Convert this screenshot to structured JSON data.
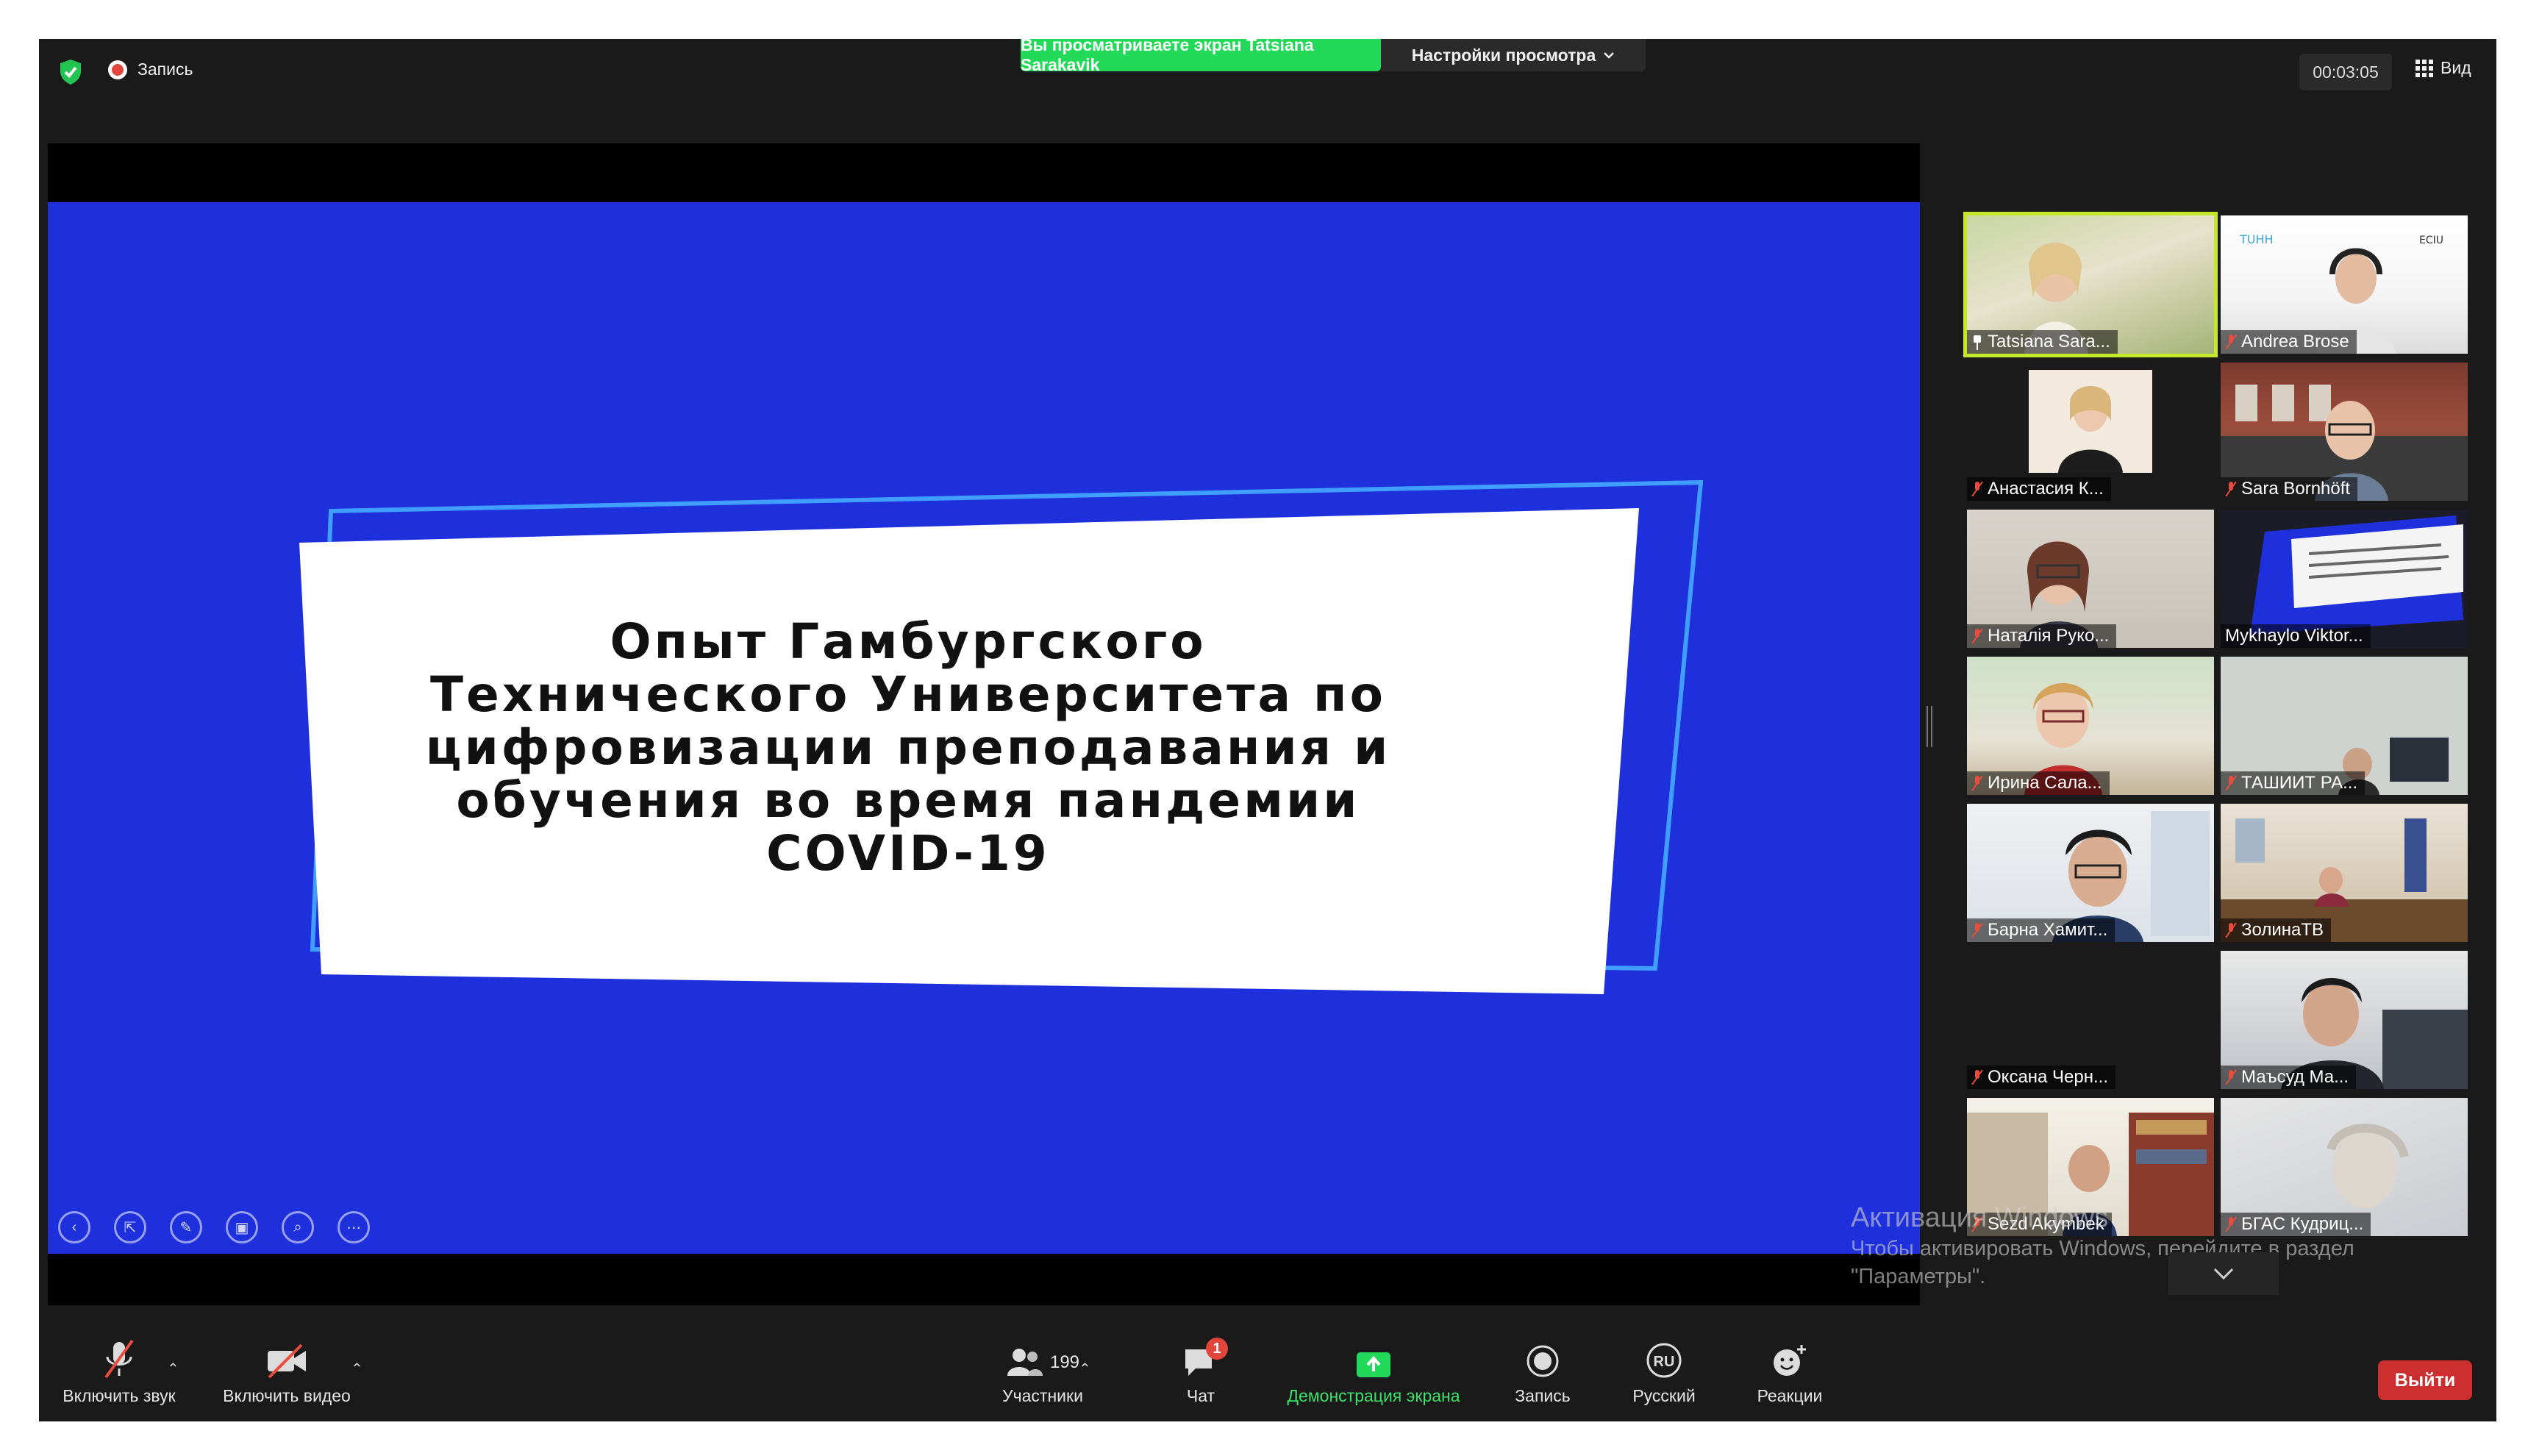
{
  "top": {
    "record_label": "Запись",
    "share_banner": "Вы просматриваете экран Tatsiana Sarakavik",
    "view_settings": "Настройки просмотра",
    "timer": "00:03:05",
    "view_label": "Вид"
  },
  "slide": {
    "title_lines": [
      "Опыт Гамбургского",
      "Технического Университета по",
      "цифровизации преподавания и",
      "обучения во время пандемии",
      "COVID-19"
    ]
  },
  "participants": [
    {
      "name": "Tatsiana Sara...",
      "state": "pinned"
    },
    {
      "name": "Andrea Brose",
      "state": "muted"
    },
    {
      "name": "Анастасия К...",
      "state": "muted"
    },
    {
      "name": "Sara Bornhöft",
      "state": "muted"
    },
    {
      "name": "Наталія Руко...",
      "state": "muted"
    },
    {
      "name": "Mykhaylo Viktor...",
      "state": "none"
    },
    {
      "name": "Ирина Сала...",
      "state": "muted"
    },
    {
      "name": "ТАШИИТ РА...",
      "state": "muted"
    },
    {
      "name": "Барна Хамит...",
      "state": "muted"
    },
    {
      "name": "ЗолинаТВ",
      "state": "muted"
    },
    {
      "name": "Оксана Черн...",
      "state": "muted"
    },
    {
      "name": "Маъсуд Ма...",
      "state": "muted"
    },
    {
      "name": "Sezd Akymbek",
      "state": "muted"
    },
    {
      "name": "БГАС Кудриц...",
      "state": "muted"
    }
  ],
  "watermark": {
    "title": "Активация Windows",
    "line1": "Чтобы активировать Windows, перейдите в раздел",
    "line2": "\"Параметры\"."
  },
  "toolbar": {
    "audio": "Включить звук",
    "video": "Включить видео",
    "participants": "Участники",
    "participants_count": "199",
    "chat": "Чат",
    "chat_badge": "1",
    "share": "Демонстрация экрана",
    "record": "Запись",
    "language": "Русский",
    "language_code": "RU",
    "reactions": "Реакции",
    "leave": "Выйти"
  },
  "colors": {
    "slide_bg": "#1e30dc",
    "share_green": "#23d959",
    "active_outline": "#c5e82a",
    "leave_red": "#cc2f2f",
    "muted_red": "#e84c3d"
  }
}
